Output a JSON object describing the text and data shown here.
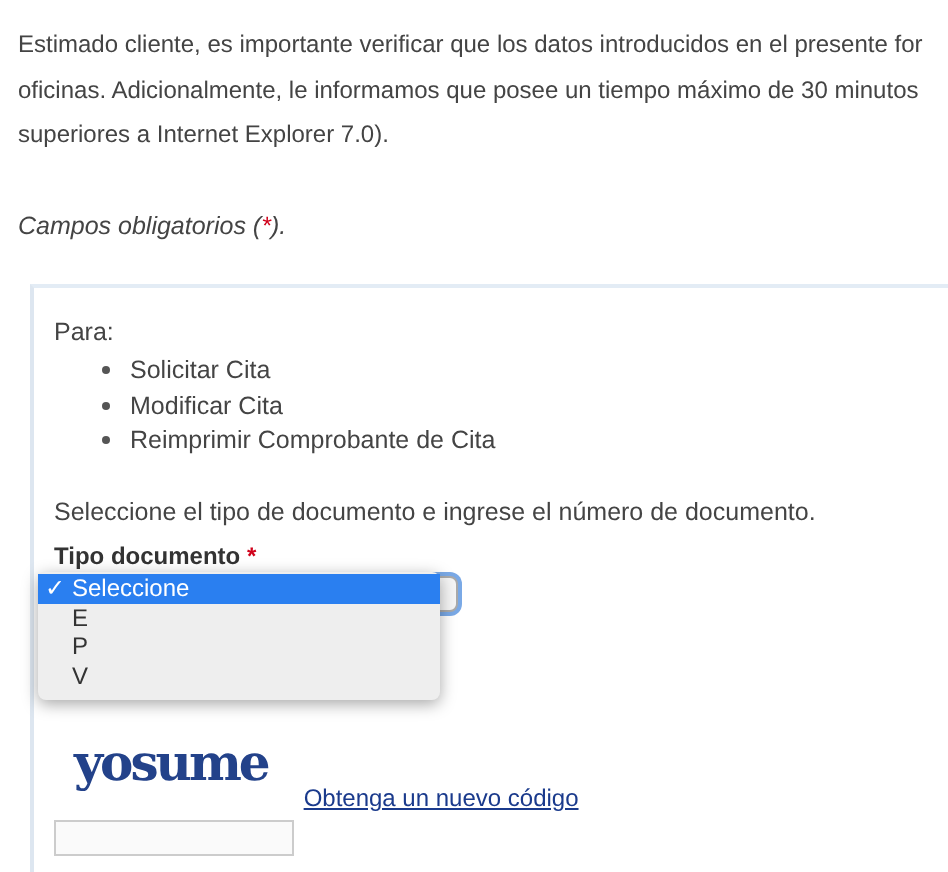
{
  "intro_lines": [
    "Estimado cliente, es importante verificar que los datos introducidos en el presente for",
    "oficinas. Adicionalmente, le informamos que posee un tiempo máximo de 30 minutos",
    "superiores a Internet Explorer 7.0)."
  ],
  "required_note": {
    "before": "Campos obligatorios (",
    "mark": "*",
    "after": ")."
  },
  "panel": {
    "lead": "Para:",
    "items": [
      "Solicitar Cita",
      "Modificar Cita",
      "Reimprimir Comprobante de Cita"
    ],
    "instruction": "Seleccione el tipo de documento e ingrese el número de documento.",
    "field_label": {
      "text": "Tipo documento",
      "mark": "*"
    },
    "dropdown": {
      "expanded": true,
      "check_glyph": "✓",
      "options": [
        {
          "label": "Seleccione",
          "selected": true
        },
        {
          "label": "E",
          "selected": false
        },
        {
          "label": "P",
          "selected": false
        },
        {
          "label": "V",
          "selected": false
        }
      ]
    },
    "captcha_word": "yosume",
    "captcha_link": "Obtenga un nuevo código"
  }
}
